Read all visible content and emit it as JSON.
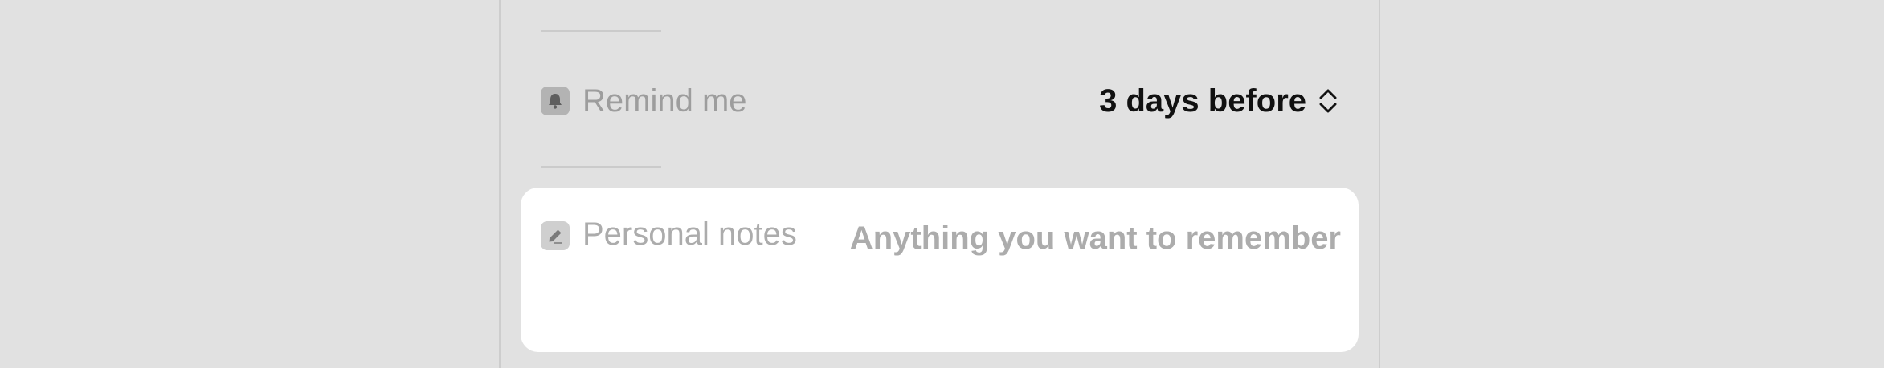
{
  "reminder": {
    "label": "Remind me",
    "value": "3 days before",
    "icon": "bell-icon"
  },
  "notes": {
    "label": "Personal notes",
    "placeholder": "Anything you want to remember",
    "value": "",
    "icon": "pencil-icon"
  },
  "colors": {
    "background": "#e1e1e1",
    "card": "#ffffff",
    "label": "#9d9d9d",
    "value": "#111111"
  }
}
